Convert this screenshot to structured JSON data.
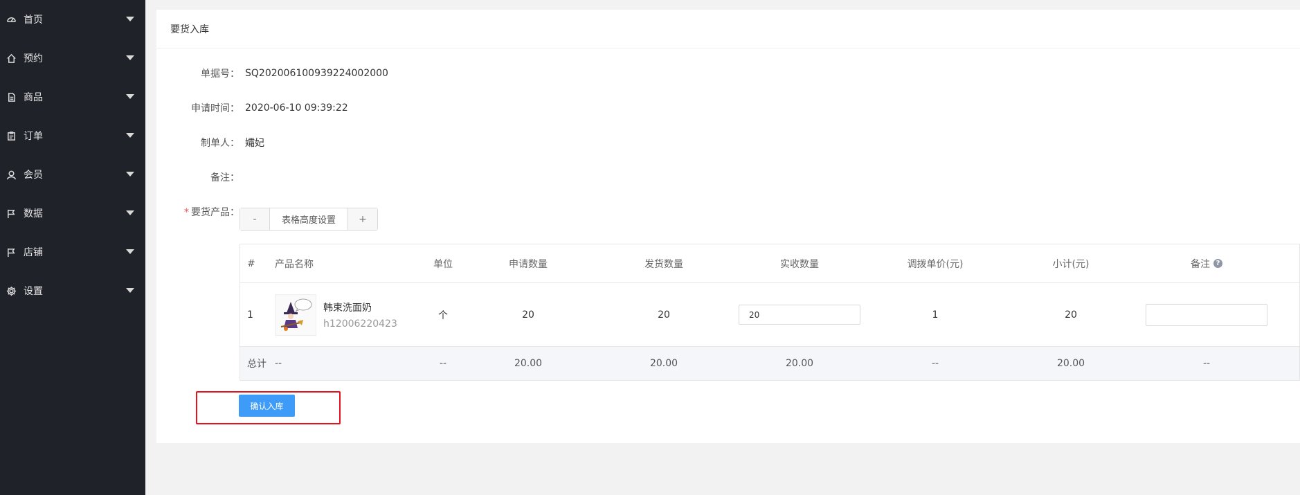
{
  "sidebar": {
    "items": [
      {
        "label": "首页",
        "icon": "dashboard-icon"
      },
      {
        "label": "预约",
        "icon": "home-icon"
      },
      {
        "label": "商品",
        "icon": "document-icon"
      },
      {
        "label": "订单",
        "icon": "clipboard-icon"
      },
      {
        "label": "会员",
        "icon": "user-icon"
      },
      {
        "label": "数据",
        "icon": "flag-icon"
      },
      {
        "label": "店铺",
        "icon": "flag-icon"
      },
      {
        "label": "设置",
        "icon": "gear-icon"
      }
    ]
  },
  "page": {
    "title": "要货入库"
  },
  "form": {
    "order_no_label": "单据号",
    "order_no": "SQ202006100939224002000",
    "apply_time_label": "申请时间",
    "apply_time": "2020-06-10 09:39:22",
    "creator_label": "制单人",
    "creator": "孀妃",
    "remark_label": "备注",
    "remark": "",
    "products_label": "要货产品",
    "colon": "："
  },
  "stepper": {
    "minus": "-",
    "label": "表格高度设置",
    "plus": "+"
  },
  "table": {
    "headers": [
      "#",
      "产品名称",
      "单位",
      "申请数量",
      "发货数量",
      "实收数量",
      "调拨单价(元)",
      "小计(元)",
      "备注"
    ],
    "help_glyph": "?",
    "rows": [
      {
        "index": "1",
        "product_name": "韩束洗面奶",
        "product_code": "h12006220423",
        "unit": "个",
        "apply_qty": "20",
        "ship_qty": "20",
        "recv_qty": "20",
        "unit_price": "1",
        "subtotal": "20",
        "note": ""
      }
    ],
    "total": {
      "label": "总计",
      "name": "--",
      "unit": "--",
      "apply_qty": "20.00",
      "ship_qty": "20.00",
      "recv_qty": "20.00",
      "unit_price": "--",
      "subtotal": "20.00",
      "note": "--"
    }
  },
  "actions": {
    "confirm_label": "确认入库"
  },
  "colors": {
    "sidebar_bg": "#20222a",
    "primary": "#3e9bf8",
    "highlight_border": "#e8131a"
  }
}
